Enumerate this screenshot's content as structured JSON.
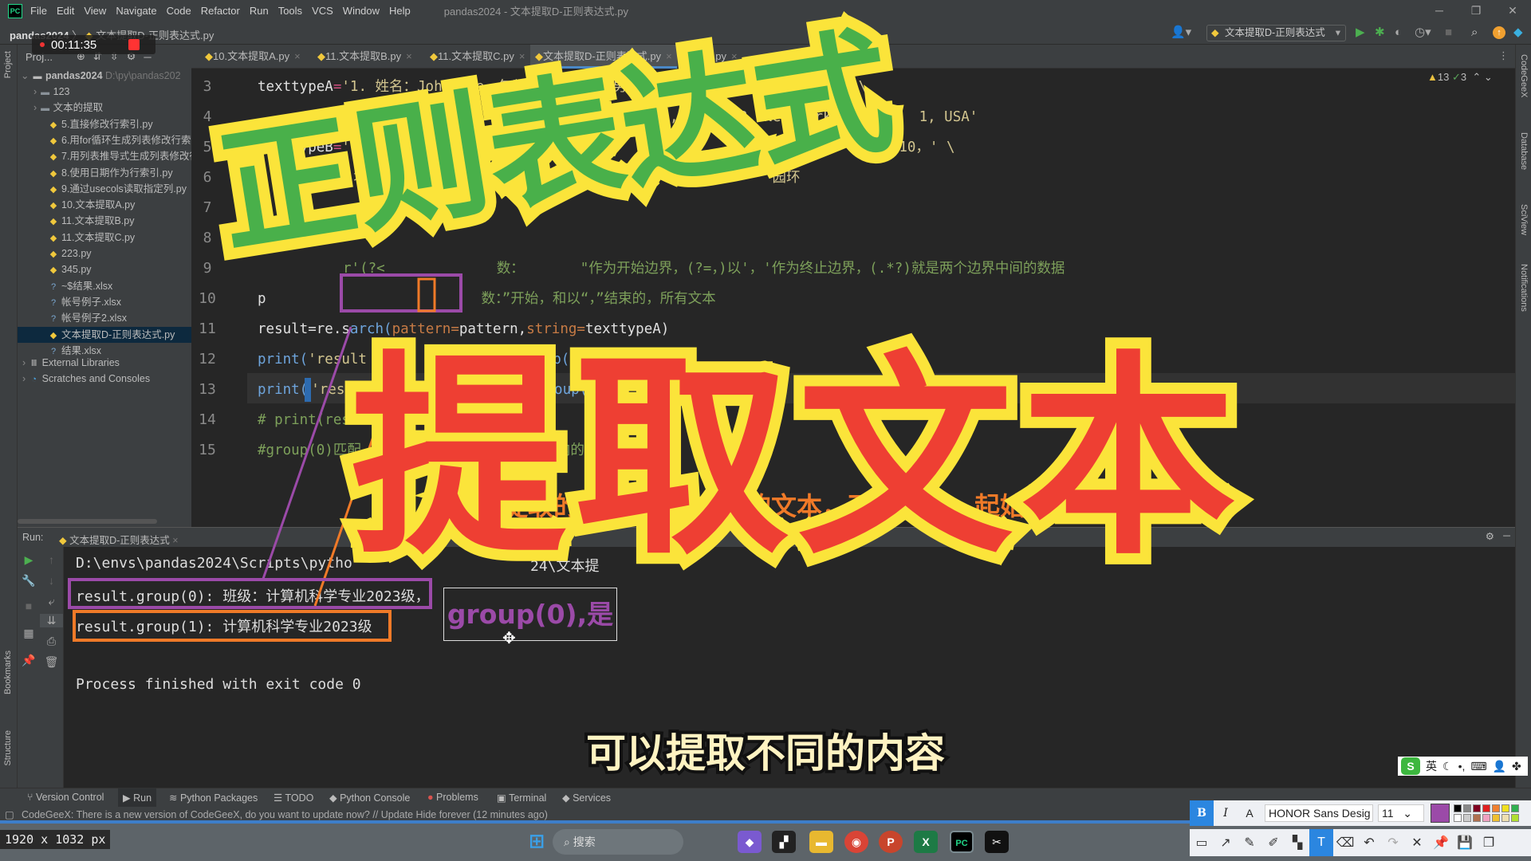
{
  "titlebar": {
    "logo": "PC",
    "menu": [
      "File",
      "Edit",
      "View",
      "Navigate",
      "Code",
      "Refactor",
      "Run",
      "Tools",
      "VCS",
      "Window",
      "Help"
    ],
    "window_title": "pandas2024 - 文本提取D-正则表达式.py"
  },
  "navbar": {
    "project": "pandas2024",
    "file": "文本提取D-正则表达式.py",
    "run_config": "文本提取D-正则表达式"
  },
  "recorder": {
    "time": "00:11:35"
  },
  "project_panel": {
    "header": "Proj...",
    "root": "pandas2024",
    "root_path": "D:\\py\\pandas202",
    "items": [
      {
        "label": "123",
        "type": "folder"
      },
      {
        "label": "文本的提取",
        "type": "folder"
      },
      {
        "label": "5.直接修改行索引.py",
        "type": "py"
      },
      {
        "label": "6.用for循环生成列表修改行索",
        "type": "py"
      },
      {
        "label": "7.用列表推导式生成列表修改行",
        "type": "py"
      },
      {
        "label": "8.使用日期作为行索引.py",
        "type": "py"
      },
      {
        "label": "9.通过usecols读取指定列.py",
        "type": "py"
      },
      {
        "label": "10.文本提取A.py",
        "type": "py"
      },
      {
        "label": "11.文本提取B.py",
        "type": "py"
      },
      {
        "label": "11.文本提取C.py",
        "type": "py"
      },
      {
        "label": "223.py",
        "type": "py"
      },
      {
        "label": "345.py",
        "type": "py"
      },
      {
        "label": "~$结果.xlsx",
        "type": "unknown"
      },
      {
        "label": "帐号例子.xlsx",
        "type": "unknown"
      },
      {
        "label": "帐号例子2.xlsx",
        "type": "unknown"
      },
      {
        "label": "文本提取D-正则表达式.py",
        "type": "py",
        "selected": true
      },
      {
        "label": "结果.xlsx",
        "type": "unknown"
      }
    ],
    "external": "External Libraries",
    "scratches": "Scratches and Consoles"
  },
  "tabs": [
    "10.文本提取A.py",
    "11.文本提取B.py",
    "11.文本提取C.py",
    "文本提取D-正则表达式.py",
    "223.py"
  ],
  "editor": {
    "warnings": "13",
    "weak_warnings": "3",
    "line_numbers": [
      "3",
      "4",
      "5",
      "6",
      "7",
      "8",
      "9",
      "10",
      "11",
      "12",
      "13",
      "14",
      "15"
    ],
    "lines": {
      "l3a": "texttypeA",
      "l3b": "=",
      "l3c": "'1. 姓名：John Doe，年龄：20，性别：男，班级：计算机科学专业2023级，' \\",
      "l4a": "'学号：CS20231001，住址：123 Maple Street, Apt",
      "l4b": "B, New York",
      "l4c": "1, USA'",
      "l5a": "texttypeB",
      "l5b": "=",
      "l5c": "'10. 姓名：林星辰，年纪：20，",
      "l5d": "23-0010，' \\",
      "l6a": "'地址",
      "l6b": "园环",
      "l9a": "r'(?<",
      "l9b": "数：",
      "l9c": "\"作为开始边界，(?=，)以'，'作为终止边界，(.*?)就是两个边界中间的数据",
      "l10a": "p",
      "l10b": "数：”开始，和以“，”结束的，所有文本",
      "l11a": "result=re.s",
      "l11b": "arch(",
      "l11c": "pattern=",
      "l11d": "pattern,",
      "l11e": "string=",
      "l11f": "texttypeA)",
      "l12a": "print(",
      "l12b": "'result",
      "l12c": "t.group(0))",
      "l13a": "print(",
      "l13b": "'resu",
      "l13c": "t.group(1",
      "l14": "# print(resu",
      "l15a": "#group(0)匹配",
      "l15b": "括号内的数"
    }
  },
  "run": {
    "label": "Run:",
    "tab": "文本提取D-正则表达式",
    "lines": [
      "D:\\envs\\pandas2024\\Scripts\\pytho",
      "24\\文本提",
      "result.group(0): 班级：计算机科学专业2023级，",
      "result.group(1): 计算机科学专业2023级",
      "Process finished with exit code 0"
    ]
  },
  "bottom_tabs": [
    "Version Control",
    "Run",
    "Python Packages",
    "TODO",
    "Python Console",
    "Problems",
    "Terminal",
    "Services"
  ],
  "status": "CodeGeeX: There is a new version of CodeGeeX, do you want to update now? // Update   Hide forever (12 minutes ago)",
  "right_stripe": [
    "CodeGeeX",
    "Database",
    "SciView",
    "Notifications"
  ],
  "left_stripe": [
    "Project",
    "Bookmarks",
    "Structure"
  ],
  "overlay": {
    "title_green": "正则表达式",
    "title_red": "提取文本",
    "orange_fragments": [
      "提取的",
      "的文本，不",
      "起始和终"
    ],
    "tooltip": "group(0),是",
    "subtitle": "可以提取不同的内容",
    "colors": {
      "green": "#49b04a",
      "red": "#ee3f33",
      "stroke": "#fbe43a",
      "purple": "#9b4aa8",
      "orange": "#f07a28"
    }
  },
  "ime": {
    "logo": "S",
    "mode": "英"
  },
  "annotator": {
    "font": "HONOR Sans Desig",
    "size": "11",
    "color": "#9b4aa8"
  },
  "taskbar": {
    "search": "搜索",
    "dims": "1920 x 1032 px"
  }
}
